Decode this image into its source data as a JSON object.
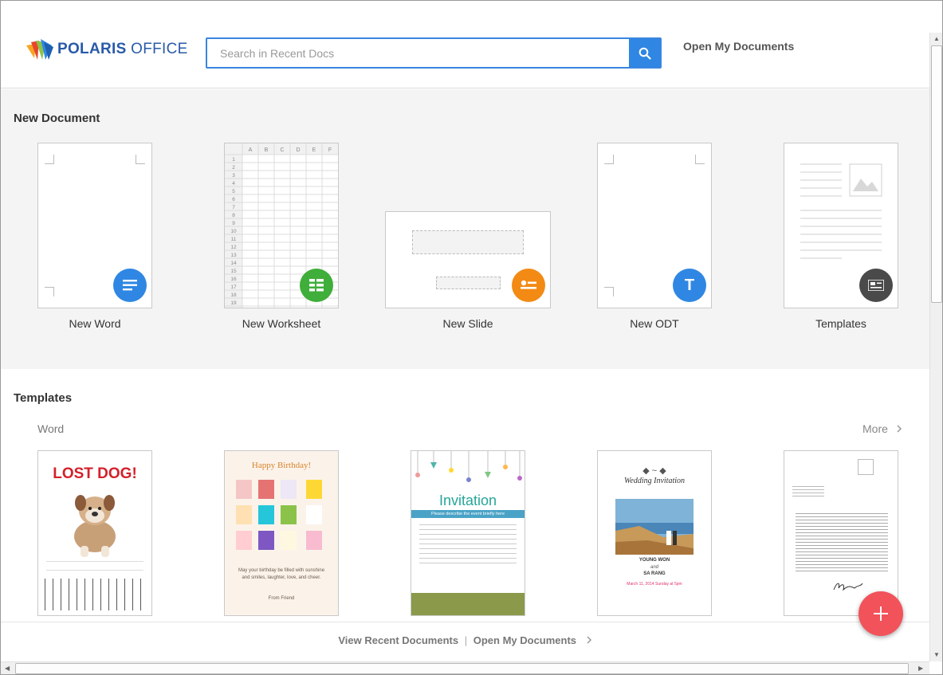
{
  "app": {
    "brand_bold": "POLARIS",
    "brand_light": " OFFICE"
  },
  "search": {
    "placeholder": "Search in Recent Docs"
  },
  "header": {
    "open_my_documents": "Open My Documents"
  },
  "new_document": {
    "title": "New Document",
    "items": [
      {
        "label": "New Word",
        "icon": "lines-icon",
        "color": "#2f87e3"
      },
      {
        "label": "New Worksheet",
        "icon": "grid-icon",
        "color": "#3fae3a"
      },
      {
        "label": "New Slide",
        "icon": "slide-icon",
        "color": "#f28a14"
      },
      {
        "label": "New ODT",
        "icon": "letter-t-icon",
        "color": "#2f87e3"
      },
      {
        "label": "Templates",
        "icon": "template-icon",
        "color": "#4a4a4a"
      }
    ],
    "sheet_columns": [
      "A",
      "B",
      "C",
      "D",
      "E",
      "F"
    ],
    "sheet_rows": [
      "1",
      "2",
      "3",
      "4",
      "5",
      "6",
      "7",
      "8",
      "9",
      "10",
      "11",
      "12",
      "13",
      "14",
      "15",
      "16",
      "17",
      "18",
      "19"
    ],
    "odt_letter": "T"
  },
  "templates": {
    "title": "Templates",
    "category": "Word",
    "more": "More",
    "lost_dog": {
      "heading": "LOST DOG!"
    },
    "birthday": {
      "heading": "Happy Birthday!",
      "body": "May your birthday be filled with sunshine and smiles, laughter, love, and cheer.",
      "from": "From Friend"
    },
    "invitation": {
      "heading": "Invitation",
      "subheading": "Please describe the event briefly here"
    },
    "wedding": {
      "heading": "Wedding Invitation",
      "names_1": "YOUNG WON",
      "names_and": "and",
      "names_2": "SA RANG",
      "date": "March 11, 2014 Sunday at 5pm"
    }
  },
  "footer": {
    "recent": "View Recent Documents",
    "separator": "|",
    "open": "Open My Documents"
  },
  "colors": {
    "accent": "#2f87e3",
    "fab": "#f2525a"
  }
}
